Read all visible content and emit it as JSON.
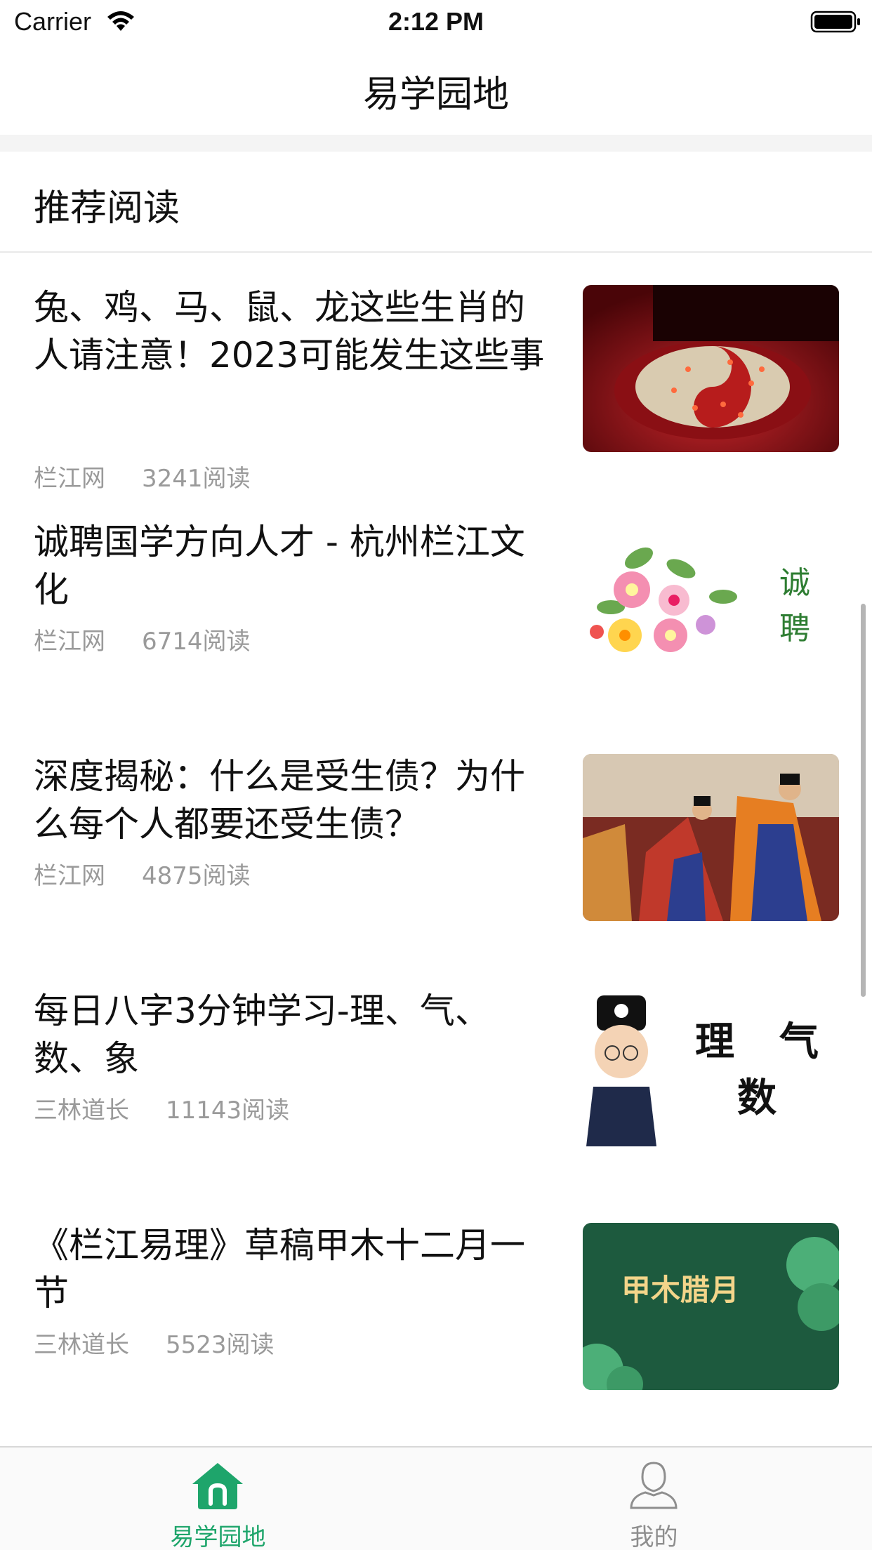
{
  "status_bar": {
    "carrier": "Carrier",
    "time": "2:12 PM"
  },
  "nav": {
    "title": "易学园地"
  },
  "section": {
    "title": "推荐阅读"
  },
  "articles": [
    {
      "title": "兔、鸡、马、鼠、龙这些生肖的人请注意！2023可能发生这些事",
      "source": "栏江网",
      "reads": "3241阅读"
    },
    {
      "title": "诚聘国学方向人才 - 杭州栏江文化",
      "source": "栏江网",
      "reads": "6714阅读",
      "thumb_text": [
        "诚",
        "聘"
      ]
    },
    {
      "title": "深度揭秘：什么是受生债？为什么每个人都要还受生债？",
      "source": "栏江网",
      "reads": "4875阅读"
    },
    {
      "title": "每日八字3分钟学习-理、气、数、象",
      "source": "三林道长",
      "reads": "11143阅读",
      "thumb_text": [
        "理",
        "气",
        "数"
      ]
    },
    {
      "title": "《栏江易理》草稿甲木十二月一节",
      "source": "三林道长",
      "reads": "5523阅读",
      "thumb_text": "甲木腊月"
    }
  ],
  "tabs": [
    {
      "label": "易学园地",
      "icon": "home-icon",
      "active": true
    },
    {
      "label": "我的",
      "icon": "user-icon",
      "active": false
    }
  ],
  "colors": {
    "accent": "#1ea56b",
    "meta_text": "#9a9a9a",
    "divider": "#f4f4f4"
  }
}
